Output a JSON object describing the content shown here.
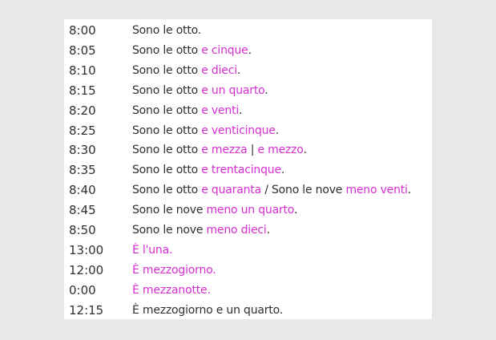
{
  "colors": {
    "background": "#e8e8e8",
    "card": "#ffffff",
    "text": "#2f2f2f",
    "accent": "#d62ecf"
  },
  "rows": [
    {
      "time": "8:00",
      "segments": [
        {
          "text": "Sono le otto.",
          "hl": false
        }
      ]
    },
    {
      "time": "8:05",
      "segments": [
        {
          "text": "Sono le otto ",
          "hl": false
        },
        {
          "text": "e cinque",
          "hl": true
        },
        {
          "text": ".",
          "hl": false
        }
      ]
    },
    {
      "time": "8:10",
      "segments": [
        {
          "text": "Sono le otto ",
          "hl": false
        },
        {
          "text": "e dieci",
          "hl": true
        },
        {
          "text": ".",
          "hl": false
        }
      ]
    },
    {
      "time": "8:15",
      "segments": [
        {
          "text": "Sono le otto ",
          "hl": false
        },
        {
          "text": "e un quarto",
          "hl": true
        },
        {
          "text": ".",
          "hl": false
        }
      ]
    },
    {
      "time": "8:20",
      "segments": [
        {
          "text": "Sono le otto ",
          "hl": false
        },
        {
          "text": "e venti",
          "hl": true
        },
        {
          "text": ".",
          "hl": false
        }
      ]
    },
    {
      "time": "8:25",
      "segments": [
        {
          "text": "Sono le otto ",
          "hl": false
        },
        {
          "text": "e venticinque",
          "hl": true
        },
        {
          "text": ".",
          "hl": false
        }
      ]
    },
    {
      "time": "8:30",
      "segments": [
        {
          "text": "Sono le otto ",
          "hl": false
        },
        {
          "text": "e mezza",
          "hl": true
        },
        {
          "text": " | ",
          "hl": false
        },
        {
          "text": "e mezzo",
          "hl": true
        },
        {
          "text": ".",
          "hl": false
        }
      ]
    },
    {
      "time": "8:35",
      "segments": [
        {
          "text": "Sono le otto ",
          "hl": false
        },
        {
          "text": "e trentacinque",
          "hl": true
        },
        {
          "text": ".",
          "hl": false
        }
      ]
    },
    {
      "time": "8:40",
      "segments": [
        {
          "text": "Sono le otto ",
          "hl": false
        },
        {
          "text": "e quaranta",
          "hl": true
        },
        {
          "text": " / Sono le nove ",
          "hl": false
        },
        {
          "text": "meno venti",
          "hl": true
        },
        {
          "text": ".",
          "hl": false
        }
      ]
    },
    {
      "time": "8:45",
      "segments": [
        {
          "text": "Sono le nove ",
          "hl": false
        },
        {
          "text": "meno un quarto",
          "hl": true
        },
        {
          "text": ".",
          "hl": false
        }
      ]
    },
    {
      "time": "8:50",
      "segments": [
        {
          "text": "Sono le nove ",
          "hl": false
        },
        {
          "text": "meno dieci",
          "hl": true
        },
        {
          "text": ".",
          "hl": false
        }
      ]
    },
    {
      "time": "13:00",
      "segments": [
        {
          "text": "È l'una.",
          "hl": true
        }
      ]
    },
    {
      "time": "12:00",
      "segments": [
        {
          "text": "È mezzogiorno.",
          "hl": true
        }
      ]
    },
    {
      "time": "0:00",
      "segments": [
        {
          "text": "È mezzanotte.",
          "hl": true
        }
      ]
    },
    {
      "time": "12:15",
      "segments": [
        {
          "text": "È mezzogiorno e un quarto.",
          "hl": false
        }
      ]
    }
  ]
}
